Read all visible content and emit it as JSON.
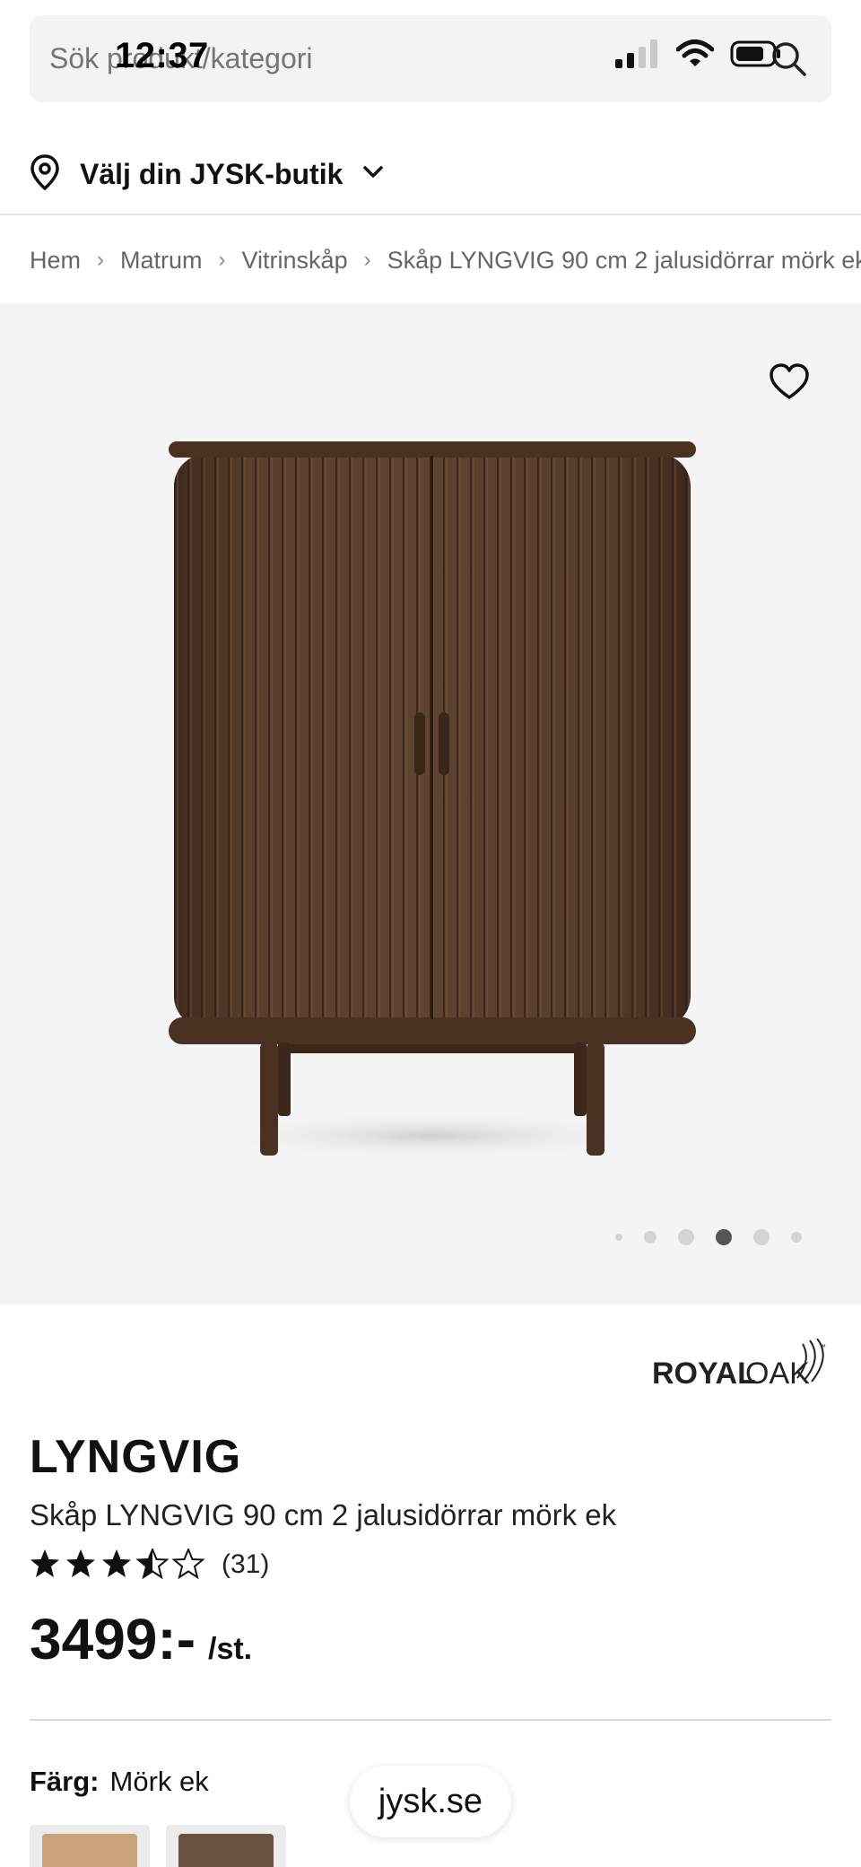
{
  "status_bar": {
    "time": "12:37"
  },
  "search": {
    "placeholder": "Sök produkt/kategori"
  },
  "store": {
    "label": "Välj din JYSK-butik"
  },
  "breadcrumb": [
    "Hem",
    "Matrum",
    "Vitrinskåp",
    "Skåp LYNGVIG 90 cm 2 jalusidörrar mörk ek"
  ],
  "gallery": {
    "image_count": 6,
    "active_index": 3
  },
  "brand": {
    "part1": "ROYAL",
    "part2": "OAK",
    "tm": "™"
  },
  "product": {
    "name": "LYNGVIG",
    "subtitle": "Skåp LYNGVIG 90 cm 2 jalusidörrar mörk ek",
    "rating": 3.5,
    "rating_max": 5,
    "review_count": "(31)",
    "price": "3499:-",
    "unit": "/st."
  },
  "color": {
    "label": "Färg:",
    "value": "Mörk ek",
    "swatches": [
      "#c9a47a",
      "#6b5140"
    ]
  },
  "domain": "jysk.se"
}
